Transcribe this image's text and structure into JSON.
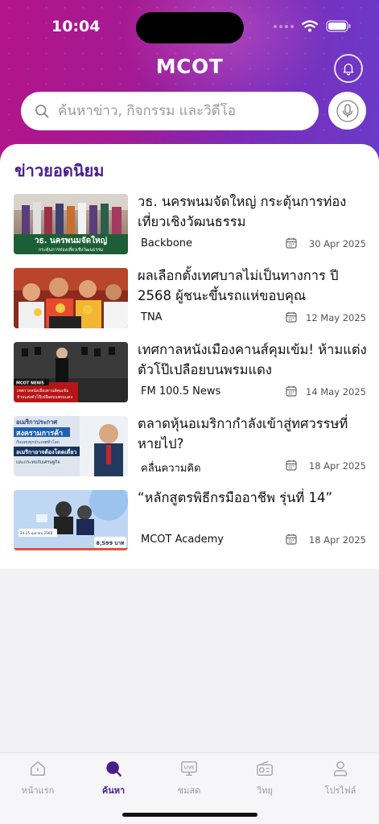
{
  "status": {
    "time": "10:04"
  },
  "header": {
    "logo_text": "MCOT"
  },
  "search": {
    "placeholder": "ค้นหาข่าว, กิจกรรม และวิดีโอ"
  },
  "section": {
    "title": "ข่าวยอดนิยม"
  },
  "news": [
    {
      "title": "วธ. นครพนมจัดใหญ่ กระตุ้นการท่องเที่ยวเชิงวัฒนธรรม",
      "source": "Backbone",
      "date": "30 Apr 2025"
    },
    {
      "title": "ผลเลือกตั้งเทศบาลไม่เป็นทางการ ปี 2568 ผู้ชนะขึ้นรถแห่ขอบคุณ",
      "source": "TNA",
      "date": "12 May 2025"
    },
    {
      "title": "เทศกาลหนังเมืองคานส์คุมเข้ม! ห้ามแต่งตัวโป๊เปลือยบนพรมแดง",
      "source": "FM 100.5 News",
      "date": "14 May 2025"
    },
    {
      "title": "ตลาดหุ้นอเมริกากำลังเข้าสู่ทศวรรษที่หายไป?",
      "source": "คลื่นความคิด",
      "date": "18 Apr 2025"
    },
    {
      "title": "“หลักสูตรพิธีกรมืออาชีพ รุ่นที่ 14”",
      "source": "MCOT Academy",
      "date": "18 Apr 2025"
    }
  ],
  "thumbs": {
    "t1": {
      "headline": "วธ. นครพนมจัดใหญ่",
      "sub": "กระตุ้นการท่องเที่ยวเชิงวัฒนธรรม"
    },
    "t3": {
      "tag": "MCOT NEWS",
      "line1": "เทศกาลหนังเมืองคานส์คุมเข้ม",
      "line2": "ห้ามแต่งตัวโป๊เปลือยบนพรมแดง"
    },
    "t4": {
      "line1": "อเมริกาประกาศ",
      "line2": "สงครามการค้า",
      "line3": "กับแทบทุกประเทศทั่วโลก",
      "line4": "อเมริกาอาจต้องโดดเดี่ยว",
      "line5": "และกระทบกับเศรษฐกิจ"
    },
    "t5": {
      "date": "24-25 เมษายน 2568",
      "price": "8,599 บาท"
    }
  },
  "tabs": [
    {
      "label": "หน้าแรก",
      "icon": "home-icon"
    },
    {
      "label": "ค้นหา",
      "icon": "search-dot-icon"
    },
    {
      "label": "ชมสด",
      "icon": "live-tv-icon"
    },
    {
      "label": "วิทยุ",
      "icon": "radio-icon"
    },
    {
      "label": "โปรไฟล์",
      "icon": "profile-icon"
    }
  ],
  "colors": {
    "brand_purple": "#4a1f8c",
    "hero_magenta": "#b4148a",
    "hero_violet": "#6a3bc9"
  }
}
